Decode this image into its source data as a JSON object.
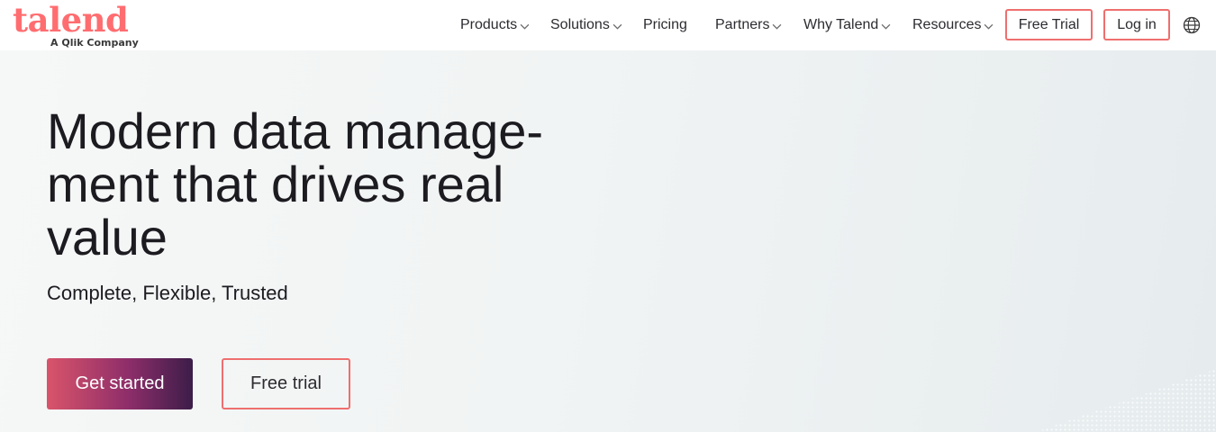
{
  "brand": {
    "name": "talend",
    "tagline": "A Qlik Company",
    "color": "#ff6d70"
  },
  "nav": {
    "items": [
      {
        "label": "Products",
        "has_dropdown": true
      },
      {
        "label": "Solutions",
        "has_dropdown": true
      },
      {
        "label": "Pricing",
        "has_dropdown": false
      },
      {
        "label": "Partners",
        "has_dropdown": true
      },
      {
        "label": "Why Talend",
        "has_dropdown": true
      },
      {
        "label": "Resources",
        "has_dropdown": true
      }
    ],
    "free_trial_label": "Free Trial",
    "login_label": "Log in",
    "language_icon": "globe-icon"
  },
  "hero": {
    "title_line1": "Modern data manage-",
    "title_line2": "ment that drives real",
    "title_line3": "value",
    "subtitle": "Complete, Flexible, Trusted",
    "primary_cta": "Get started",
    "secondary_cta": "Free trial"
  },
  "colors": {
    "accent": "#ee6f6e",
    "cta_gradient_start": "#d9546a",
    "cta_gradient_end": "#3c1d49"
  }
}
